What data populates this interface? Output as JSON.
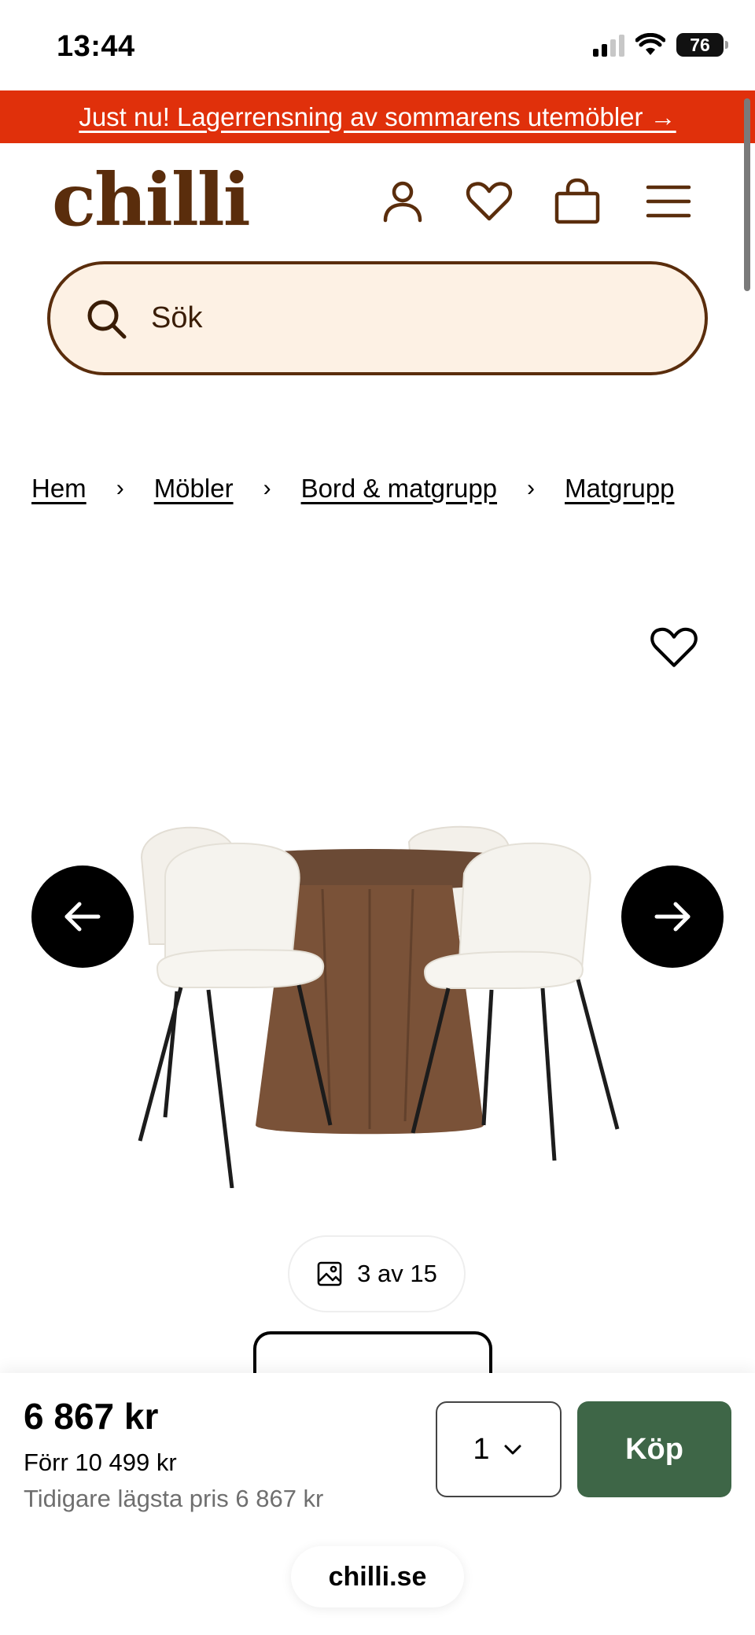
{
  "status_bar": {
    "time": "13:44",
    "battery": "76",
    "icons": [
      "signal-icon",
      "wifi-icon",
      "battery-icon"
    ]
  },
  "promo": {
    "text": "Just nu! Lagerrensning av sommarens utemöbler →"
  },
  "header": {
    "logo": "chilli",
    "icons": [
      "user-icon",
      "heart-icon",
      "bag-icon",
      "menu-icon"
    ]
  },
  "search": {
    "placeholder": "Sök"
  },
  "breadcrumb": [
    "Hem",
    "Möbler",
    "Bord & matgrupp",
    "Matgrupp"
  ],
  "gallery": {
    "counter": "3 av 15",
    "prev_icon": "arrow-left-icon",
    "next_icon": "arrow-right-icon",
    "favorite_icon": "heart-icon"
  },
  "buy": {
    "price": "6 867 kr",
    "before": "Förr 10 499 kr",
    "lowest": "Tidigare lägsta pris 6 867 kr",
    "quantity": "1",
    "button": "Köp"
  },
  "browser": {
    "url": "chilli.se"
  },
  "colors": {
    "promo": "#e0300b",
    "brand_brown": "#5a2d0c",
    "search_bg": "#fdf1e4",
    "buy_button": "#3e6647"
  }
}
